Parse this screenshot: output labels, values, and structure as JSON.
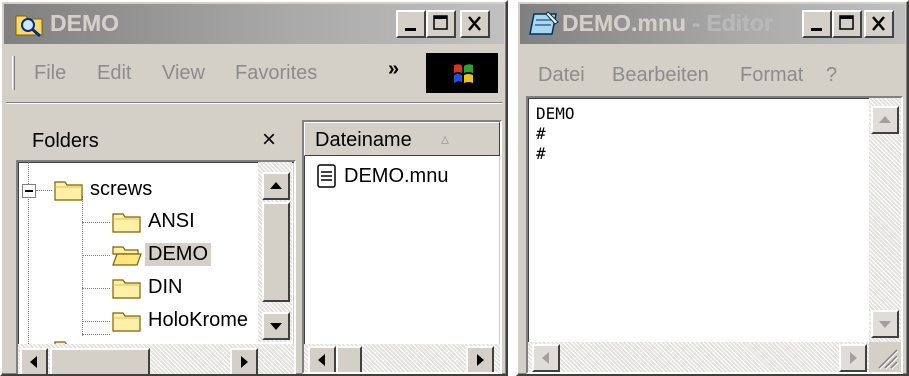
{
  "explorer": {
    "title": "DEMO",
    "menu": [
      "File",
      "Edit",
      "View",
      "Favorites"
    ],
    "menu_overflow": "»",
    "folders_pane": {
      "header": "Folders",
      "close": "×",
      "tree": [
        {
          "label": "screws",
          "expanded": true
        },
        {
          "label": "ANSI"
        },
        {
          "label": "DEMO",
          "selected": true,
          "open": true
        },
        {
          "label": "DIN"
        },
        {
          "label": "HoloKrome"
        }
      ]
    },
    "files_pane": {
      "column_header": "Dateiname",
      "sort_indicator": "▵",
      "files": [
        {
          "name": "DEMO.mnu",
          "icon": "notepad-document-icon"
        }
      ]
    }
  },
  "editor": {
    "title_main": "DEMO.mnu",
    "title_suffix": " - Editor",
    "menu": [
      "Datei",
      "Bearbeiten",
      "Format",
      "?"
    ],
    "content": "DEMO\n#\n#"
  },
  "colors": {
    "inactive_title_start": "#808080",
    "inactive_title_end": "#c0c0c0",
    "face": "#d4d0c8",
    "disabled_text": "#8c8c8c"
  }
}
